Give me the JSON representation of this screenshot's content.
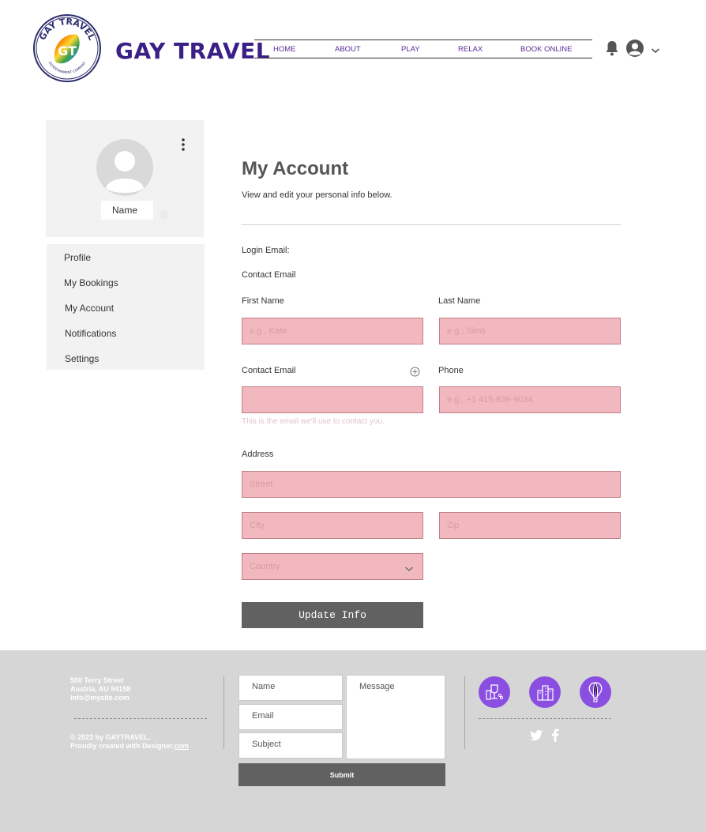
{
  "header": {
    "site_name": "GAY TRAVEL",
    "logo": {
      "top_text": "GAY TRAVEL",
      "bottom_text": "ENTERTAINMENT COMPANY",
      "monogram": "GT"
    },
    "nav": [
      {
        "label": "HOME"
      },
      {
        "label": "ABOUT"
      },
      {
        "label": "PLAY"
      },
      {
        "label": "RELAX"
      },
      {
        "label": "BOOK ONLINE"
      }
    ],
    "icons": {
      "bell": "bell-icon",
      "avatar": "avatar-icon",
      "dropdown": "chevron-down-icon"
    }
  },
  "sidebar": {
    "profile_name": "Name",
    "menu": [
      {
        "label": "Profile"
      },
      {
        "label": "My Bookings"
      },
      {
        "label": "My Account"
      },
      {
        "label": "Notifications"
      },
      {
        "label": "Settings"
      }
    ]
  },
  "main": {
    "title": "My Account",
    "subtitle": "View and edit your personal info below.",
    "login_email_label": "Login Email:",
    "contact_email_heading": "Contact Email",
    "first_name": {
      "label": "First Name",
      "placeholder": "e.g., Kate",
      "value": ""
    },
    "last_name": {
      "label": "Last Name",
      "placeholder": "e.g., Sims",
      "value": ""
    },
    "contact_email": {
      "label": "Contact Email",
      "value": "",
      "helper": "This is the email we'll use to contact you."
    },
    "phone": {
      "label": "Phone",
      "placeholder": "e.g., +1 415-639-9034",
      "value": ""
    },
    "address": {
      "label": "Address",
      "street": "Street",
      "city": "City",
      "zip": "Zip",
      "country": "Country"
    },
    "update_button": "Update Info"
  },
  "footer": {
    "address_line1": "500 Terry Street",
    "address_line2": "Austria, AU 94158",
    "email": "info@mysite.com",
    "copyright": "© 2023 by GAYTRAVEL.",
    "credit_prefix": "Proudly created with Designer.",
    "credit_link": "com",
    "form": {
      "name": "Name",
      "email": "Email",
      "subject": "Subject",
      "message": "Message",
      "submit": "Submit"
    }
  },
  "colors": {
    "brand_purple": "#3a1f86",
    "nav_purple": "#5a2a9a",
    "field_pink": "#f2b8c0",
    "button_gray": "#616161",
    "footer_gray": "#d6d6d6",
    "icon_purple": "#8a4fe0"
  }
}
